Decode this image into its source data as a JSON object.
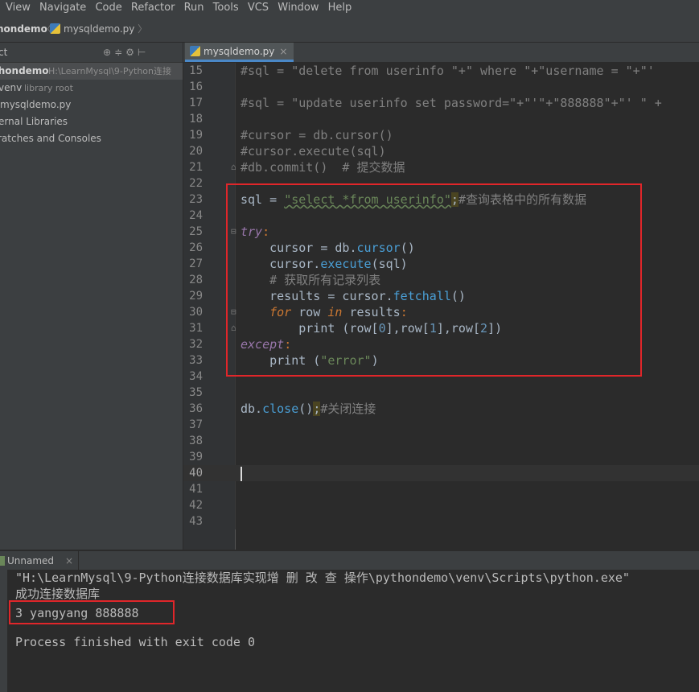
{
  "menu": [
    "View",
    "Navigate",
    "Code",
    "Refactor",
    "Run",
    "Tools",
    "VCS",
    "Window",
    "Help"
  ],
  "nav": {
    "project": "hondemo",
    "file": "mysqldemo.py"
  },
  "sidebar": {
    "header": "ct",
    "items": [
      {
        "label": "thondemo",
        "hint": "H:\\LearnMysql\\9-Python连接"
      },
      {
        "label": "venv",
        "hint": "library root"
      },
      {
        "label": "mysqldemo.py"
      },
      {
        "label": "ernal Libraries"
      },
      {
        "label": "ratches and Consoles"
      }
    ]
  },
  "editor": {
    "tab": "mysqldemo.py",
    "line_numbers": [
      "15",
      "16",
      "17",
      "18",
      "19",
      "20",
      "21",
      "22",
      "23",
      "24",
      "25",
      "26",
      "27",
      "28",
      "29",
      "30",
      "31",
      "32",
      "33",
      "34",
      "35",
      "36",
      "37",
      "38",
      "39",
      "40",
      "41",
      "42",
      "43"
    ],
    "code": {
      "l15": "#sql = \"delete from userinfo \"+\" where \"+\"username = \"+\"'",
      "l17": "#sql = \"update userinfo set password=\"+\"'\"+\"888888\"+\"' \" +",
      "l19": "#cursor = db.cursor()",
      "l20": "#cursor.execute(sql)",
      "l21": "#db.commit()  # 提交数据",
      "l23a": "sql = ",
      "l23b": "\"select *from userinfo\"",
      "l23c": ";",
      "l23d": "#查询表格中的所有数据",
      "l25": "try",
      "l26a": "    cursor = db.",
      "l26b": "cursor",
      "l26c": "()",
      "l27a": "    cursor.",
      "l27b": "execute",
      "l27c": "(sql)",
      "l28": "    # 获取所有记录列表",
      "l29a": "    results = cursor.",
      "l29b": "fetchall",
      "l29c": "()",
      "l30a": "for",
      "l30b": " row ",
      "l30c": "in",
      "l30d": " results",
      "l31a": "        print (row[",
      "l31b": "0",
      "l31c": "],row[",
      "l31d": "1",
      "l31e": "],row[",
      "l31f": "2",
      "l31g": "])",
      "l32": "except",
      "l33a": "    print (",
      "l33b": "\"error\"",
      "l33c": ")",
      "l36a": "db.",
      "l36b": "close",
      "l36c": "()",
      "l36d": ";",
      "l36e": "#关闭连接"
    }
  },
  "run": {
    "tab": "Unnamed",
    "output": [
      "\"H:\\LearnMysql\\9-Python连接数据库实现增 删 改 查 操作\\pythondemo\\venv\\Scripts\\python.exe\" ",
      "成功连接数据库",
      "3 yangyang 888888",
      "",
      "Process finished with exit code 0"
    ]
  },
  "colors": {
    "highlight_box": "#e0262a",
    "editor_bg": "#2b2b2b",
    "panel_bg": "#3c3f41"
  }
}
